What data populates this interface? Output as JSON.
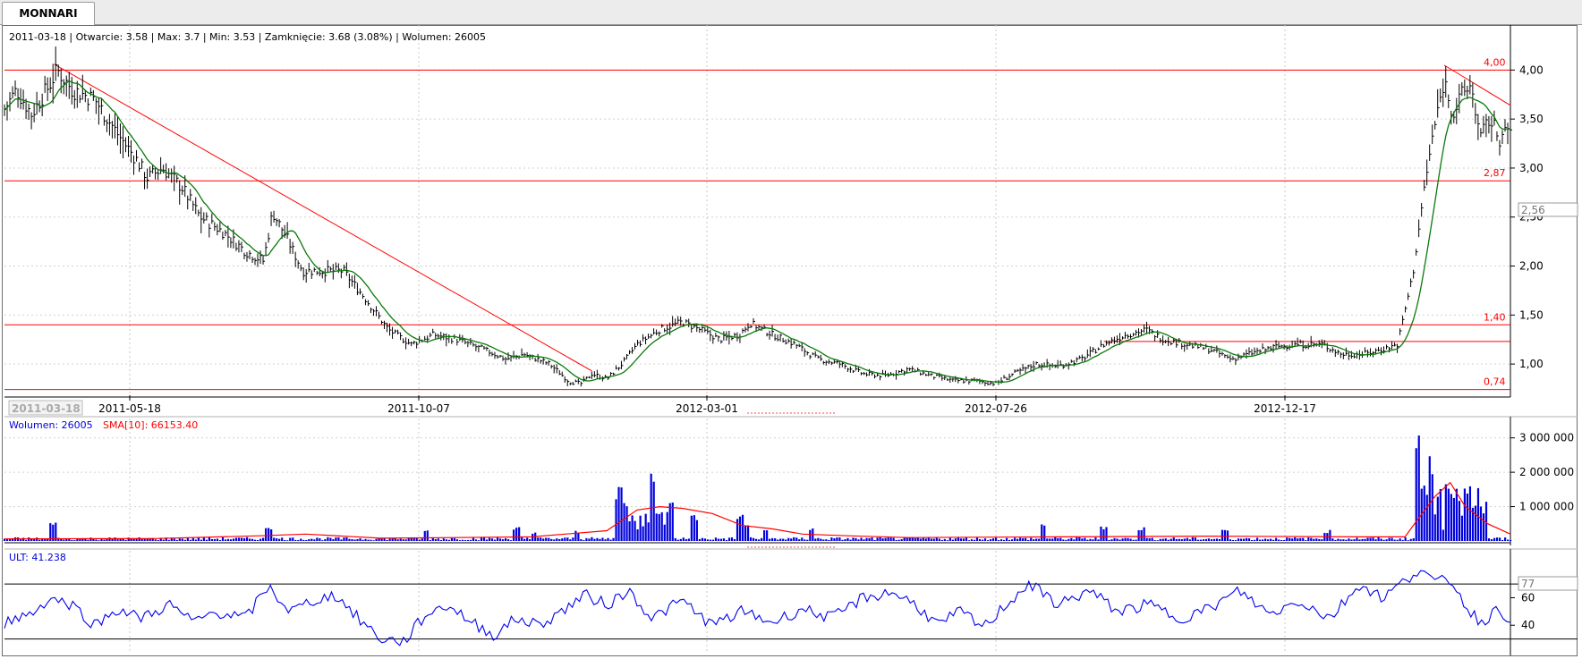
{
  "tab": {
    "label": "MONNARI"
  },
  "colors": {
    "price": "#000000",
    "sma": "#0a7a0a",
    "levels": "#ff0000",
    "volume": "#0000dd",
    "volume_sma": "#ff0000",
    "ult": "#0000ee"
  },
  "price_panel": {
    "info": "2011-03-18 | Otwarcie: 3.58 | Max: 3.7 | Min: 3.53 | Zamknięcie: 3.68 (3.08%)  | Wolumen: 26005",
    "cursor_date": "2011-03-18",
    "current_value": "2,56"
  },
  "volume_panel": {
    "legend_volume": "Wolumen: 26005",
    "legend_sma": "SMA[10]: 66153.40"
  },
  "ult_panel": {
    "legend": "ULT: 41.238",
    "current_value": "77"
  },
  "chart_data": [
    {
      "type": "line",
      "panel": "price",
      "x_tick_labels": [
        "2011-05-18",
        "2011-10-07",
        "2012-03-01",
        "2012-07-26",
        "2012-12-17"
      ],
      "y_ticks": [
        "1,00",
        "1,50",
        "2,00",
        "2,50",
        "3,00",
        "3,50",
        "4,00"
      ],
      "ylim": [
        0.7,
        4.35
      ],
      "grid": true,
      "levels": [
        {
          "value": 4.0,
          "label": "4,00"
        },
        {
          "value": 2.87,
          "label": "2,87"
        },
        {
          "value": 1.4,
          "label": "1,40"
        },
        {
          "value": 0.74,
          "label": "0,74"
        }
      ],
      "trendlines": [
        {
          "from": [
            0.033,
            4.06
          ],
          "to": [
            0.39,
            0.93
          ]
        },
        {
          "from": [
            0.73,
            1.23
          ],
          "to": [
            1.0,
            1.23
          ]
        },
        {
          "from": [
            0.956,
            4.05
          ],
          "to": [
            1.0,
            3.64
          ]
        }
      ],
      "close_path": [
        [
          0.0,
          3.6
        ],
        [
          0.008,
          3.8
        ],
        [
          0.018,
          3.55
        ],
        [
          0.03,
          3.85
        ],
        [
          0.035,
          4.0
        ],
        [
          0.045,
          3.8
        ],
        [
          0.06,
          3.7
        ],
        [
          0.075,
          3.35
        ],
        [
          0.087,
          3.1
        ],
        [
          0.095,
          2.9
        ],
        [
          0.105,
          3.0
        ],
        [
          0.118,
          2.8
        ],
        [
          0.13,
          2.5
        ],
        [
          0.145,
          2.35
        ],
        [
          0.16,
          2.15
        ],
        [
          0.172,
          2.05
        ],
        [
          0.178,
          2.55
        ],
        [
          0.187,
          2.3
        ],
        [
          0.198,
          1.95
        ],
        [
          0.212,
          1.95
        ],
        [
          0.225,
          1.95
        ],
        [
          0.238,
          1.7
        ],
        [
          0.255,
          1.35
        ],
        [
          0.27,
          1.2
        ],
        [
          0.285,
          1.3
        ],
        [
          0.3,
          1.25
        ],
        [
          0.318,
          1.15
        ],
        [
          0.333,
          1.05
        ],
        [
          0.345,
          1.1
        ],
        [
          0.362,
          1.0
        ],
        [
          0.375,
          0.82
        ],
        [
          0.383,
          0.8
        ],
        [
          0.39,
          0.9
        ],
        [
          0.4,
          0.85
        ],
        [
          0.41,
          1.0
        ],
        [
          0.42,
          1.2
        ],
        [
          0.435,
          1.35
        ],
        [
          0.45,
          1.43
        ],
        [
          0.462,
          1.35
        ],
        [
          0.475,
          1.25
        ],
        [
          0.488,
          1.3
        ],
        [
          0.495,
          1.42
        ],
        [
          0.51,
          1.3
        ],
        [
          0.525,
          1.2
        ],
        [
          0.54,
          1.05
        ],
        [
          0.555,
          1.0
        ],
        [
          0.57,
          0.9
        ],
        [
          0.585,
          0.88
        ],
        [
          0.6,
          0.95
        ],
        [
          0.615,
          0.88
        ],
        [
          0.63,
          0.83
        ],
        [
          0.645,
          0.83
        ],
        [
          0.658,
          0.8
        ],
        [
          0.67,
          0.9
        ],
        [
          0.685,
          1.0
        ],
        [
          0.7,
          0.98
        ],
        [
          0.715,
          1.05
        ],
        [
          0.73,
          1.2
        ],
        [
          0.745,
          1.3
        ],
        [
          0.758,
          1.35
        ],
        [
          0.77,
          1.25
        ],
        [
          0.785,
          1.2
        ],
        [
          0.8,
          1.15
        ],
        [
          0.815,
          1.05
        ],
        [
          0.83,
          1.12
        ],
        [
          0.845,
          1.18
        ],
        [
          0.86,
          1.2
        ],
        [
          0.875,
          1.2
        ],
        [
          0.888,
          1.1
        ],
        [
          0.902,
          1.1
        ],
        [
          0.915,
          1.15
        ],
        [
          0.925,
          1.2
        ],
        [
          0.935,
          1.9
        ],
        [
          0.942,
          2.7
        ],
        [
          0.948,
          3.3
        ],
        [
          0.956,
          3.9
        ],
        [
          0.962,
          3.55
        ],
        [
          0.968,
          3.75
        ],
        [
          0.974,
          3.85
        ],
        [
          0.98,
          3.3
        ],
        [
          0.986,
          3.5
        ],
        [
          0.993,
          3.3
        ],
        [
          1.0,
          3.4
        ]
      ]
    },
    {
      "type": "bar",
      "panel": "volume",
      "series": [
        {
          "name": "Wolumen"
        },
        {
          "name": "SMA[10]"
        }
      ],
      "y_ticks": [
        "1 000 000",
        "2 000 000",
        "3 000 000"
      ],
      "ylim": [
        0,
        3200000
      ],
      "spikes": [
        [
          0.032,
          600000
        ],
        [
          0.175,
          480000
        ],
        [
          0.28,
          350000
        ],
        [
          0.34,
          420000
        ],
        [
          0.352,
          300000
        ],
        [
          0.38,
          320000
        ],
        [
          0.408,
          1700000
        ],
        [
          0.412,
          1350000
        ],
        [
          0.418,
          800000
        ],
        [
          0.43,
          2200000
        ],
        [
          0.436,
          1100000
        ],
        [
          0.443,
          1200000
        ],
        [
          0.458,
          800000
        ],
        [
          0.488,
          850000
        ],
        [
          0.493,
          550000
        ],
        [
          0.505,
          350000
        ],
        [
          0.536,
          400000
        ],
        [
          0.69,
          560000
        ],
        [
          0.73,
          480000
        ],
        [
          0.755,
          420000
        ],
        [
          0.81,
          380000
        ],
        [
          0.878,
          330000
        ],
        [
          0.938,
          3100000
        ],
        [
          0.942,
          2150000
        ],
        [
          0.947,
          2700000
        ],
        [
          0.953,
          1750000
        ],
        [
          0.958,
          2000000
        ],
        [
          0.963,
          1600000
        ],
        [
          0.975,
          1150000
        ],
        [
          0.983,
          550000
        ]
      ],
      "sma_path": [
        [
          0.0,
          60000
        ],
        [
          0.1,
          70000
        ],
        [
          0.17,
          150000
        ],
        [
          0.2,
          200000
        ],
        [
          0.25,
          80000
        ],
        [
          0.3,
          100000
        ],
        [
          0.35,
          120000
        ],
        [
          0.4,
          300000
        ],
        [
          0.42,
          900000
        ],
        [
          0.435,
          1000000
        ],
        [
          0.45,
          950000
        ],
        [
          0.47,
          800000
        ],
        [
          0.49,
          450000
        ],
        [
          0.51,
          350000
        ],
        [
          0.53,
          200000
        ],
        [
          0.56,
          150000
        ],
        [
          0.6,
          100000
        ],
        [
          0.7,
          120000
        ],
        [
          0.8,
          140000
        ],
        [
          0.9,
          120000
        ],
        [
          0.93,
          120000
        ],
        [
          0.938,
          600000
        ],
        [
          0.95,
          1300000
        ],
        [
          0.96,
          1700000
        ],
        [
          0.97,
          1000000
        ],
        [
          0.985,
          500000
        ],
        [
          1.0,
          200000
        ]
      ]
    },
    {
      "type": "line",
      "panel": "ult",
      "series": [
        {
          "name": "ULT"
        }
      ],
      "y_ticks": [
        "40",
        "60"
      ],
      "ylim": [
        20,
        85
      ],
      "bands": [
        30,
        70
      ],
      "path": [
        [
          0.0,
          42
        ],
        [
          0.02,
          50
        ],
        [
          0.03,
          60
        ],
        [
          0.045,
          55
        ],
        [
          0.06,
          40
        ],
        [
          0.075,
          52
        ],
        [
          0.09,
          45
        ],
        [
          0.11,
          55
        ],
        [
          0.125,
          42
        ],
        [
          0.14,
          50
        ],
        [
          0.16,
          45
        ],
        [
          0.175,
          68
        ],
        [
          0.19,
          50
        ],
        [
          0.205,
          58
        ],
        [
          0.22,
          62
        ],
        [
          0.235,
          45
        ],
        [
          0.25,
          30
        ],
        [
          0.265,
          28
        ],
        [
          0.28,
          48
        ],
        [
          0.295,
          55
        ],
        [
          0.31,
          42
        ],
        [
          0.325,
          33
        ],
        [
          0.34,
          45
        ],
        [
          0.355,
          40
        ],
        [
          0.37,
          50
        ],
        [
          0.385,
          62
        ],
        [
          0.4,
          55
        ],
        [
          0.415,
          65
        ],
        [
          0.43,
          45
        ],
        [
          0.45,
          58
        ],
        [
          0.47,
          40
        ],
        [
          0.49,
          50
        ],
        [
          0.51,
          42
        ],
        [
          0.53,
          52
        ],
        [
          0.55,
          45
        ],
        [
          0.57,
          60
        ],
        [
          0.59,
          64
        ],
        [
          0.605,
          55
        ],
        [
          0.62,
          40
        ],
        [
          0.635,
          50
        ],
        [
          0.65,
          38
        ],
        [
          0.665,
          55
        ],
        [
          0.68,
          70
        ],
        [
          0.7,
          55
        ],
        [
          0.72,
          65
        ],
        [
          0.74,
          50
        ],
        [
          0.76,
          55
        ],
        [
          0.78,
          45
        ],
        [
          0.8,
          52
        ],
        [
          0.82,
          65
        ],
        [
          0.84,
          48
        ],
        [
          0.86,
          58
        ],
        [
          0.88,
          45
        ],
        [
          0.9,
          70
        ],
        [
          0.915,
          60
        ],
        [
          0.93,
          72
        ],
        [
          0.94,
          82
        ],
        [
          0.95,
          70
        ],
        [
          0.96,
          74
        ],
        [
          0.97,
          55
        ],
        [
          0.98,
          42
        ],
        [
          0.99,
          50
        ],
        [
          1.0,
          46
        ]
      ]
    }
  ]
}
